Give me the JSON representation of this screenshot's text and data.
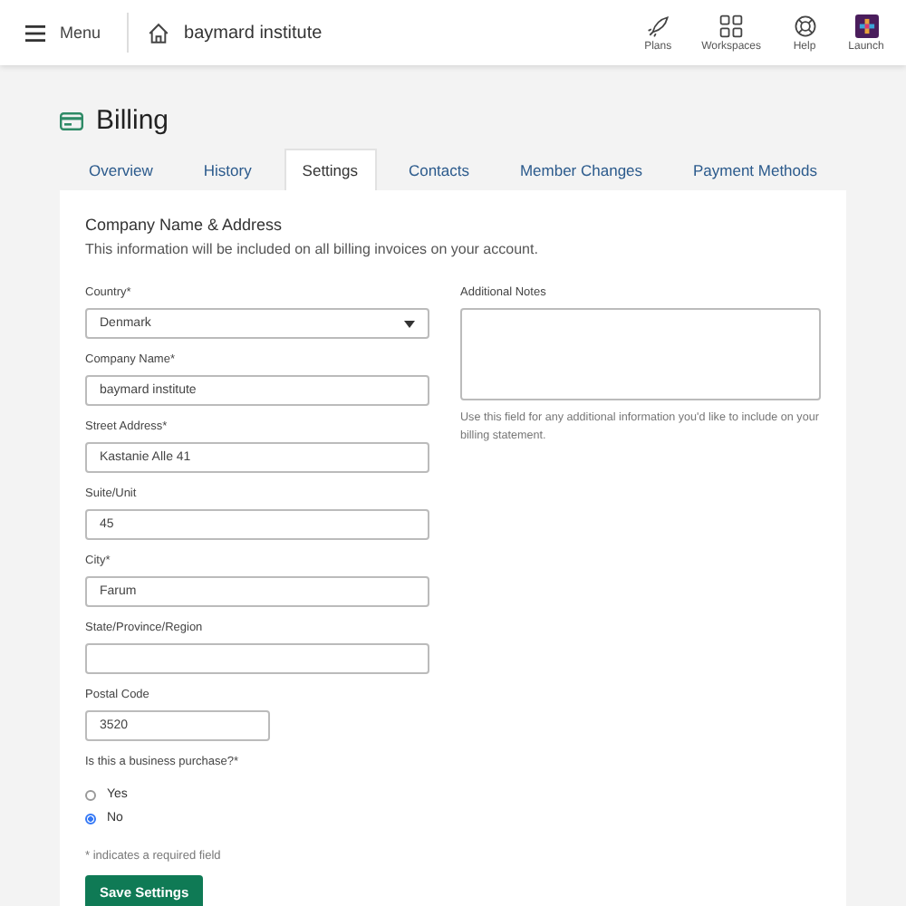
{
  "header": {
    "menu_label": "Menu",
    "org_name": "baymard institute",
    "actions": [
      {
        "kind": "plans",
        "label": "Plans"
      },
      {
        "kind": "workspaces",
        "label": "Workspaces"
      },
      {
        "kind": "help",
        "label": "Help"
      },
      {
        "kind": "launch",
        "label": "Launch"
      }
    ]
  },
  "page_title": "Billing",
  "tabs": [
    {
      "label": "Overview",
      "selected": false
    },
    {
      "label": "History",
      "selected": false
    },
    {
      "label": "Settings",
      "selected": true
    },
    {
      "label": "Contacts",
      "selected": false
    },
    {
      "label": "Member Changes",
      "selected": false
    },
    {
      "label": "Payment Methods",
      "selected": false
    }
  ],
  "section": {
    "title": "Company Name & Address",
    "description": "This information will be included on all billing invoices on your account."
  },
  "fields": [
    {
      "kind": "select",
      "label": "Country*",
      "value": "Denmark"
    },
    {
      "kind": "text",
      "label": "Company Name*",
      "value": "baymard institute"
    },
    {
      "kind": "text",
      "label": "Street Address*",
      "value": "Kastanie Alle 41"
    },
    {
      "kind": "text",
      "label": "Suite/Unit",
      "value": "45"
    },
    {
      "kind": "text",
      "label": "City*",
      "value": "Farum"
    },
    {
      "kind": "text",
      "label": "State/Province/Region"
    },
    {
      "kind": "short",
      "label": "Postal Code",
      "value": "3520"
    }
  ],
  "notes": {
    "label": "Additional Notes",
    "help": "Use this field for any additional information you'd like to include on your billing statement."
  },
  "business_question": {
    "label": "Is this a business purchase?*",
    "options": [
      {
        "label": "Yes",
        "selected": false
      },
      {
        "label": "No",
        "selected": true
      }
    ]
  },
  "required_note": "* indicates a required field",
  "save_button": "Save Settings"
}
